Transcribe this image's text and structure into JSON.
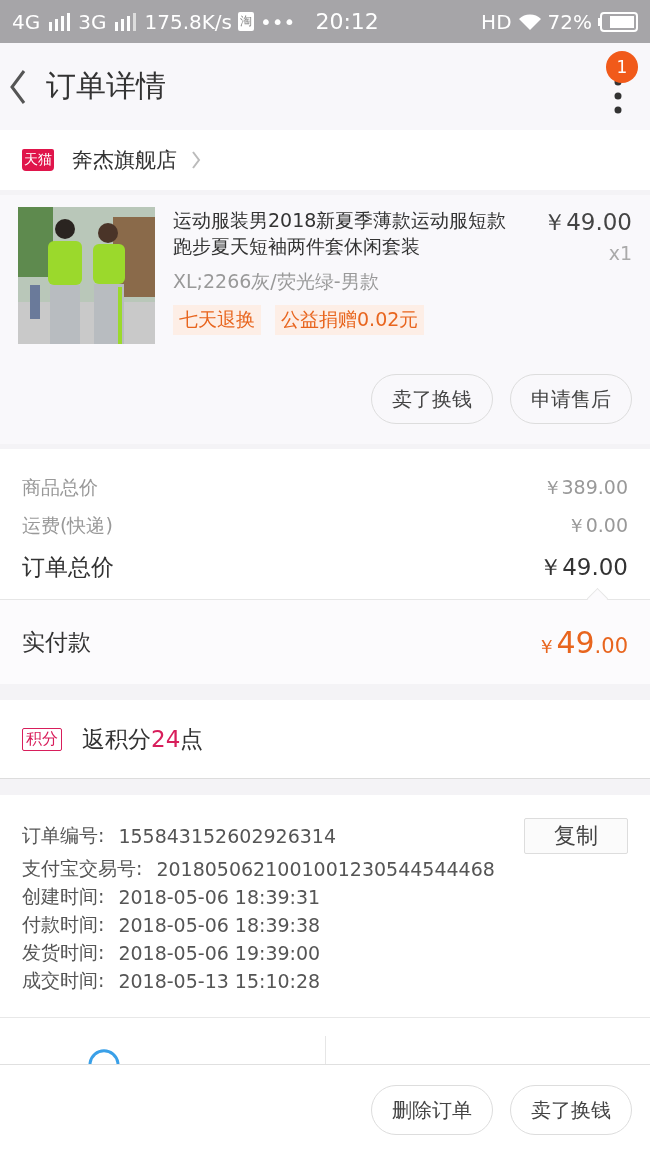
{
  "status_bar": {
    "network_1": "4G",
    "network_2": "3G",
    "speed": "175.8K/s",
    "app_badge": "淘",
    "more": "•••",
    "time": "20:12",
    "hd": "HD",
    "battery": "72%"
  },
  "header": {
    "title": "订单详情",
    "notification_count": "1"
  },
  "store": {
    "platform_logo": "天猫",
    "name": "奔杰旗舰店"
  },
  "product": {
    "kind": "picture",
    "title": "运动服装男2018新夏季薄款运动服短款跑步夏天短袖两件套休闲套装",
    "price": "￥49.00",
    "quantity": "x1",
    "sku": "XL;2266灰/荧光绿-男款",
    "tags": [
      "七天退换",
      "公益捐赠0.02元"
    ],
    "actions": [
      "卖了换钱",
      "申请售后"
    ]
  },
  "costs": [
    {
      "label": "商品总价",
      "value": "￥389.00",
      "emphasis": false
    },
    {
      "label": "运费(快递)",
      "value": "￥0.00",
      "emphasis": false
    },
    {
      "label": "订单总价",
      "value": "￥49.00",
      "emphasis": true
    }
  ],
  "paid": {
    "label": "实付款",
    "currency": "￥",
    "integer": "49",
    "decimals": ".00"
  },
  "points": {
    "badge": "积分",
    "prefix": "返积分",
    "amount": "24",
    "suffix": "点"
  },
  "order_info": {
    "copy_button": "复制",
    "rows": [
      {
        "label": "订单编号:",
        "value": "155843152602926314"
      },
      {
        "label": "支付宝交易号:",
        "value": "2018050621001001230544544468"
      },
      {
        "label": "创建时间:",
        "value": "2018-05-06 18:39:31"
      },
      {
        "label": "付款时间:",
        "value": "2018-05-06 18:39:38"
      },
      {
        "label": "发货时间:",
        "value": "2018-05-06 19:39:00"
      },
      {
        "label": "成交时间:",
        "value": "2018-05-13 15:10:28"
      }
    ]
  },
  "bottom_actions": [
    "删除订单",
    "卖了换钱"
  ]
}
